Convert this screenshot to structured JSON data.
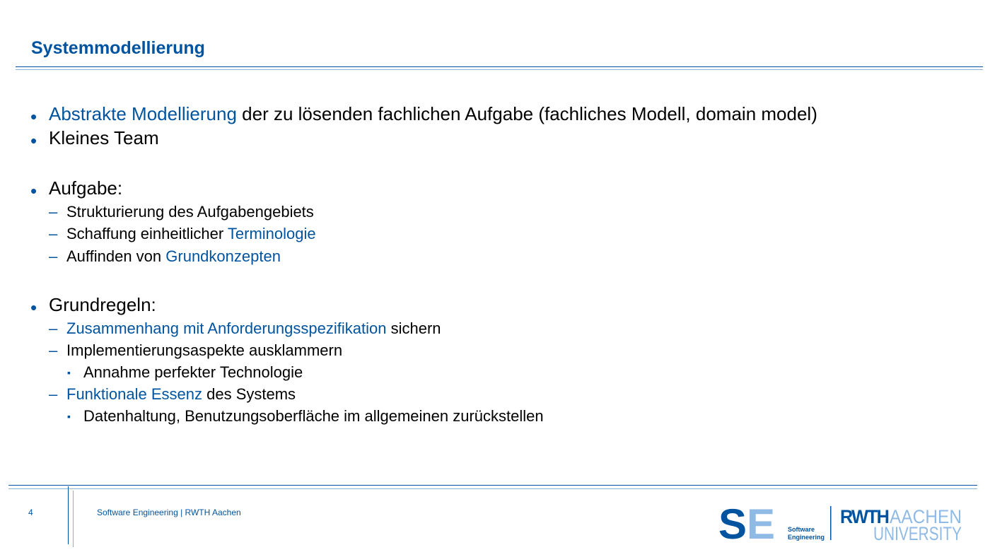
{
  "title": "Systemmodellierung",
  "bullets": {
    "b1": {
      "highlight": "Abstrakte Modellierung",
      "rest": " der zu lösenden fachlichen Aufgabe (fachliches Modell, domain model)"
    },
    "b2": "Kleines Team",
    "b3": "Aufgabe:",
    "b3_subs": {
      "s1": "Strukturierung des Aufgabengebiets",
      "s2_pre": "Schaffung einheitlicher ",
      "s2_hl": "Terminologie",
      "s3_pre": "Auffinden von ",
      "s3_hl": "Grundkonzepten"
    },
    "b4": "Grundregeln:",
    "b4_subs": {
      "s1_hl": "Zusammenhang mit Anforderungsspezifikation",
      "s1_rest": " sichern",
      "s2": "Implementierungsaspekte ausklammern",
      "s2_sub": "Annahme perfekter Technologie",
      "s3_hl": "Funktionale Essenz",
      "s3_rest": " des Systems",
      "s3_sub": "Datenhaltung, Benutzungsoberfläche im allgemeinen zurückstellen"
    }
  },
  "glyphs": {
    "bullet": "•",
    "dash": "–",
    "square": "▪"
  },
  "footer": {
    "page_number": "4",
    "text": "Software Engineering  |  RWTH Aachen"
  },
  "logos": {
    "se_mark": "SE",
    "se_text_1": "Software",
    "se_text_2": "Engineering",
    "rwth_1": "RWTH",
    "rwth_2": "AACHEN",
    "rwth_3": "UNIVERSITY"
  },
  "colors": {
    "accent": "#00549f",
    "light_accent": "#8ebae5"
  }
}
